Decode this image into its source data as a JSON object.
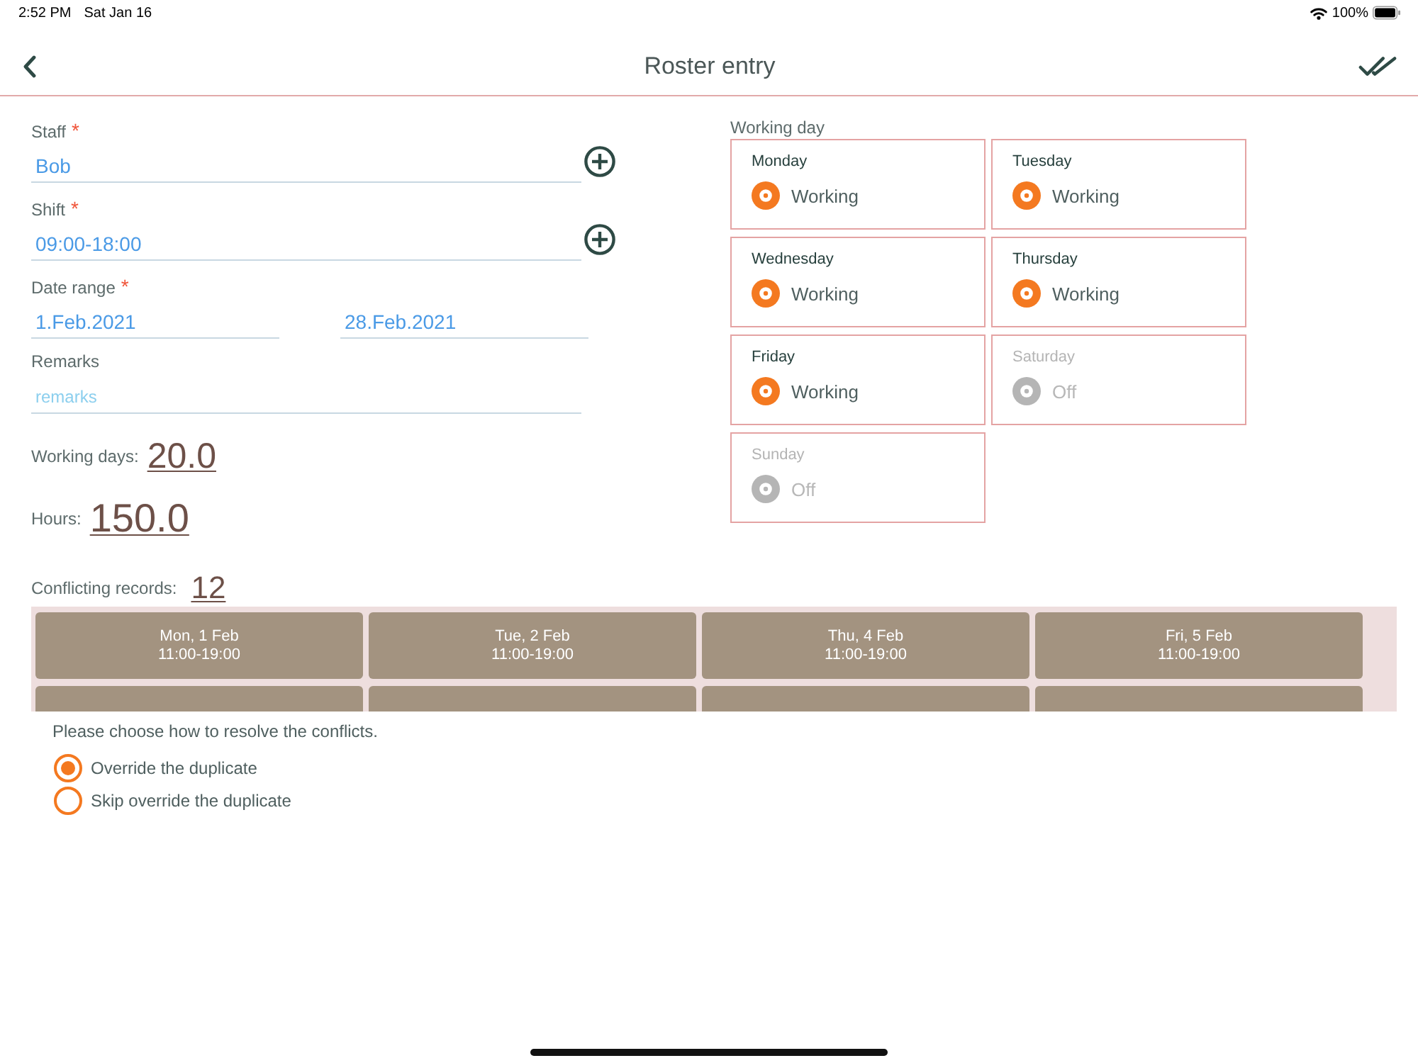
{
  "status_bar": {
    "time": "2:52 PM",
    "date": "Sat Jan 16",
    "battery": "100%"
  },
  "nav_bar": {
    "title": "Roster entry"
  },
  "form": {
    "fields": [
      {
        "kind": "text",
        "label": "Staff",
        "required_mark": "*",
        "value": "Bob",
        "add_button": true
      },
      {
        "kind": "text",
        "label": "Shift",
        "required_mark": "*",
        "value": "09:00-18:00",
        "add_button": true
      },
      {
        "kind": "date_range",
        "label": "Date range",
        "required_mark": "*",
        "values": [
          "1.Feb.2021",
          "28.Feb.2021"
        ]
      },
      {
        "kind": "text",
        "label": "Remarks",
        "placeholder": "remarks",
        "add_button": false
      }
    ],
    "totals": [
      {
        "label": "Working days:",
        "value": "20.0"
      },
      {
        "label": "Hours:",
        "value": "150.0"
      }
    ]
  },
  "working_day": {
    "title": "Working day",
    "days": [
      {
        "name": "Monday",
        "on": true,
        "status": "Working"
      },
      {
        "name": "Tuesday",
        "on": true,
        "status": "Working"
      },
      {
        "name": "Wednesday",
        "on": true,
        "status": "Working"
      },
      {
        "name": "Thursday",
        "on": true,
        "status": "Working"
      },
      {
        "name": "Friday",
        "on": true,
        "status": "Working"
      },
      {
        "name": "Saturday",
        "on": false,
        "status": "Off"
      },
      {
        "name": "Sunday",
        "on": false,
        "status": "Off"
      }
    ]
  },
  "conflicts": {
    "label": "Conflicting records:",
    "count": "12",
    "records": [
      {
        "date": "Mon, 1 Feb",
        "time": "11:00-19:00"
      },
      {
        "date": "Tue, 2 Feb",
        "time": "11:00-19:00"
      },
      {
        "date": "Thu, 4 Feb",
        "time": "11:00-19:00"
      },
      {
        "date": "Fri, 5 Feb",
        "time": "11:00-19:00"
      }
    ],
    "prompt": "Please choose how to resolve the conflicts.",
    "options": [
      {
        "label": "Override the duplicate",
        "selected": true
      },
      {
        "label": "Skip override the duplicate",
        "selected": false
      }
    ]
  }
}
